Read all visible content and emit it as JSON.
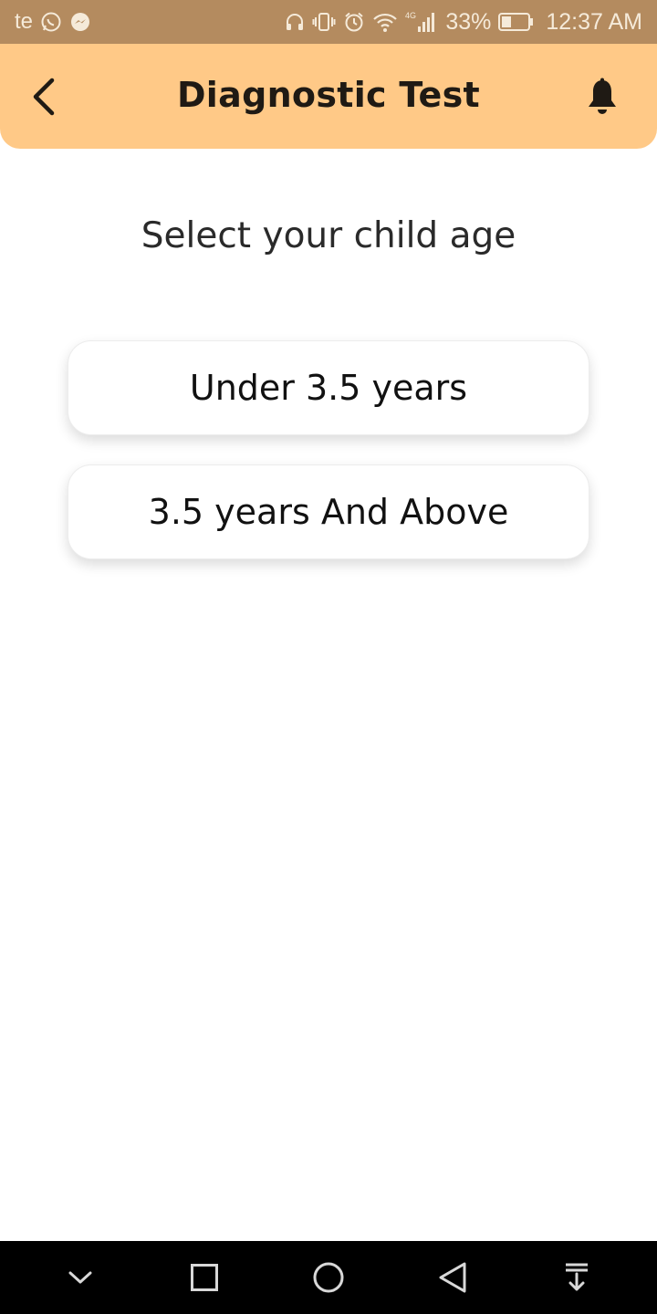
{
  "status_bar": {
    "carrier": "te",
    "battery_percent": "33%",
    "time": "12:37 AM",
    "network": "4G",
    "icons_left": [
      "whatsapp-icon",
      "messenger-icon"
    ],
    "icons_right": [
      "headset-icon",
      "vibrate-icon",
      "alarm-icon",
      "wifi-icon",
      "signal-icon",
      "battery-icon"
    ]
  },
  "header": {
    "title": "Diagnostic Test",
    "back_icon": "chevron-left-icon",
    "bell_icon": "bell-icon",
    "background": "#ffc987"
  },
  "main": {
    "prompt": "Select your child age",
    "options": [
      {
        "label": "Under 3.5 years"
      },
      {
        "label": "3.5 years And Above"
      }
    ]
  },
  "nav_bar": {
    "buttons": [
      "collapse-icon",
      "recents-icon",
      "home-icon",
      "back-icon",
      "notification-pull-icon"
    ]
  },
  "colors": {
    "status_bar": "#b48b5f",
    "header": "#ffc987",
    "nav_bar": "#000000"
  }
}
